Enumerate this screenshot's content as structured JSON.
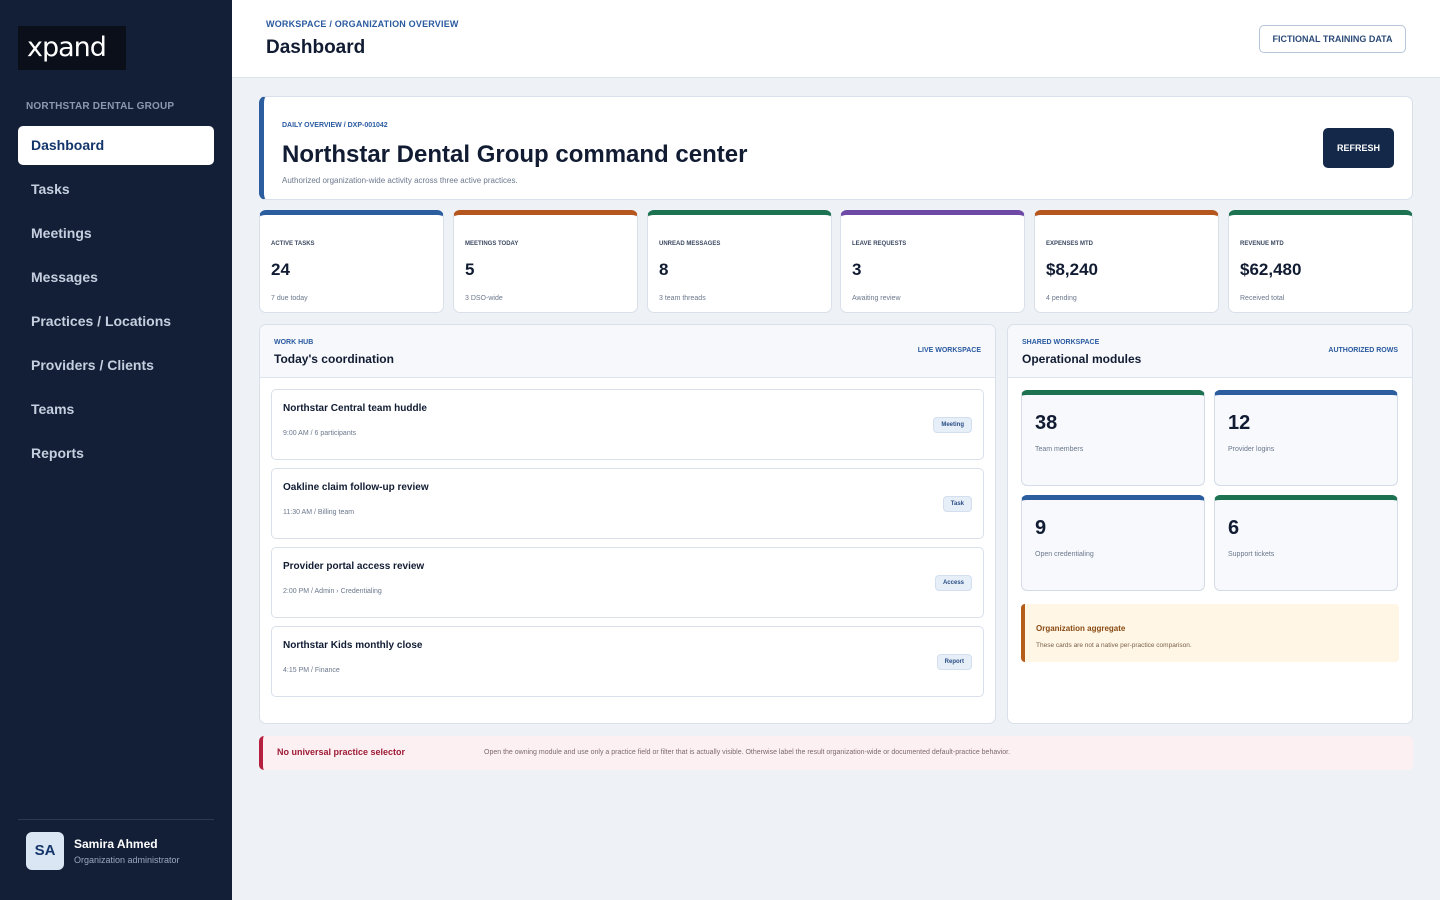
{
  "app": {
    "logo_text": "xpand"
  },
  "sidebar": {
    "org_name": "NORTHSTAR DENTAL GROUP",
    "items": [
      {
        "label": "Dashboard",
        "active": true
      },
      {
        "label": "Tasks"
      },
      {
        "label": "Meetings"
      },
      {
        "label": "Messages"
      },
      {
        "label": "Practices / Locations"
      },
      {
        "label": "Providers / Clients"
      },
      {
        "label": "Teams"
      },
      {
        "label": "Reports"
      }
    ],
    "user": {
      "initials": "SA",
      "name": "Samira Ahmed",
      "role": "Organization administrator"
    }
  },
  "header": {
    "breadcrumb": "WORKSPACE / ORGANIZATION OVERVIEW",
    "title": "Dashboard",
    "badge": "FICTIONAL TRAINING DATA"
  },
  "hero": {
    "kicker": "DAILY OVERVIEW / DXP-001042",
    "title": "Northstar Dental Group command center",
    "subtitle": "Authorized organization-wide activity across three active practices.",
    "refresh_label": "REFRESH"
  },
  "stats": [
    {
      "label": "ACTIVE TASKS",
      "value": "24",
      "note": "7 due today",
      "color": "#2c5d9f"
    },
    {
      "label": "MEETINGS TODAY",
      "value": "5",
      "note": "3 DSO-wide",
      "color": "#b5561e"
    },
    {
      "label": "UNREAD MESSAGES",
      "value": "8",
      "note": "3 team threads",
      "color": "#1d7251"
    },
    {
      "label": "LEAVE REQUESTS",
      "value": "3",
      "note": "Awaiting review",
      "color": "#6e4aa6"
    },
    {
      "label": "EXPENSES MTD",
      "value": "$8,240",
      "note": "4 pending",
      "color": "#b5561e"
    },
    {
      "label": "REVENUE MTD",
      "value": "$62,480",
      "note": "Received total",
      "color": "#1d7251"
    }
  ],
  "work_hub": {
    "kicker": "WORK HUB",
    "title": "Today's coordination",
    "tag": "LIVE WORKSPACE",
    "items": [
      {
        "title": "Northstar Central team huddle",
        "meta": "9:00 AM / 6 participants",
        "badge": "Meeting"
      },
      {
        "title": "Oakline claim follow-up review",
        "meta": "11:30 AM / Billing team",
        "badge": "Task"
      },
      {
        "title": "Provider portal access review",
        "meta": "2:00 PM / Admin › Credentialing",
        "badge": "Access"
      },
      {
        "title": "Northstar Kids monthly close",
        "meta": "4:15 PM / Finance",
        "badge": "Report"
      }
    ]
  },
  "shared": {
    "kicker": "SHARED WORKSPACE",
    "title": "Operational modules",
    "tag": "AUTHORIZED ROWS",
    "modules": [
      {
        "value": "38",
        "label": "Team members",
        "color": "#1d7251"
      },
      {
        "value": "12",
        "label": "Provider logins",
        "color": "#2c5d9f"
      },
      {
        "value": "9",
        "label": "Open credentialing",
        "color": "#2c5d9f"
      },
      {
        "value": "6",
        "label": "Support tickets",
        "color": "#1d7251"
      }
    ],
    "aggregate": {
      "title": "Organization aggregate",
      "text": "These cards are not a native per-practice comparison."
    }
  },
  "alert": {
    "title": "No universal practice selector",
    "text": "Open the owning module and use only a practice field or filter that is actually visible. Otherwise label the result organization-wide or documented default-practice behavior."
  }
}
